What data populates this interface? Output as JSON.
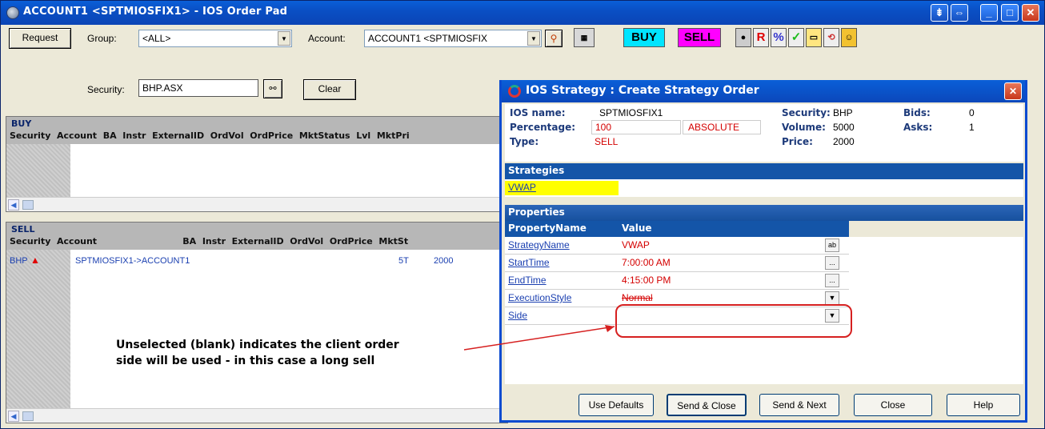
{
  "window": {
    "title": "ACCOUNT1 <SPTMIOSFIX1> - IOS Order Pad"
  },
  "toolbar": {
    "request_label": "Request",
    "group_label": "Group:",
    "group_value": "<ALL>",
    "account_label": "Account:",
    "account_value": "ACCOUNT1 <SPTMIOSFIX",
    "security_label": "Security:",
    "security_value": "BHP.ASX",
    "clear_label": "Clear",
    "buy_label": "BUY",
    "sell_label": "SELL",
    "r_label": "R",
    "pct_label": "%"
  },
  "buy_panel": {
    "title": "BUY",
    "columns": "Security  Account  BA  Instr  ExternalID  OrdVol  OrdPrice  MktStatus  Lvl  MktPri"
  },
  "sell_panel": {
    "title": "SELL",
    "columns": "Security  Account                            BA  Instr  ExternalID  OrdVol  OrdPrice  MktSt",
    "row": {
      "security": "BHP",
      "account": "SPTMIOSFIX1->ACCOUNT1",
      "vol": "5T",
      "price": "2000"
    }
  },
  "annotation": {
    "line1": "Unselected (blank) indicates the client order",
    "line2": "side will be used - in this case a long sell"
  },
  "dialog": {
    "title": "IOS Strategy : Create Strategy Order",
    "ios_name_label": "IOS name:",
    "ios_name_value": "SPTMIOSFIX1",
    "percentage_label": "Percentage:",
    "percentage_value": "100",
    "absolute_label": "ABSOLUTE",
    "type_label": "Type:",
    "type_value": "SELL",
    "security_label": "Security:",
    "security_value": "BHP",
    "volume_label": "Volume:",
    "volume_value": "5000",
    "price_label": "Price:",
    "price_value": "2000",
    "bids_label": "Bids:",
    "bids_value": "0",
    "asks_label": "Asks:",
    "asks_value": "1",
    "strategies_header": "Strategies",
    "strategy_selected": "VWAP",
    "properties_header": "Properties",
    "col_name": "PropertyName",
    "col_value": "Value",
    "properties": [
      {
        "name": "StrategyName",
        "value": "VWAP",
        "btn": "ab"
      },
      {
        "name": "StartTime",
        "value": "7:00:00 AM",
        "btn": "..."
      },
      {
        "name": "EndTime",
        "value": "4:15:00 PM",
        "btn": "..."
      },
      {
        "name": "ExecutionStyle",
        "value": "Normal",
        "btn": "▼"
      },
      {
        "name": "Side",
        "value": "",
        "btn": "▼"
      }
    ],
    "buttons": {
      "use_defaults": "Use Defaults",
      "send_close": "Send & Close",
      "send_next": "Send & Next",
      "close": "Close",
      "help": "Help"
    }
  },
  "colors": {
    "title_blue": "#0a4fc4",
    "buy_cyan": "#00e5ff",
    "sell_magenta": "#ff00ff",
    "annotation_red": "#d62020",
    "strategy_yellow": "#ffff00"
  }
}
